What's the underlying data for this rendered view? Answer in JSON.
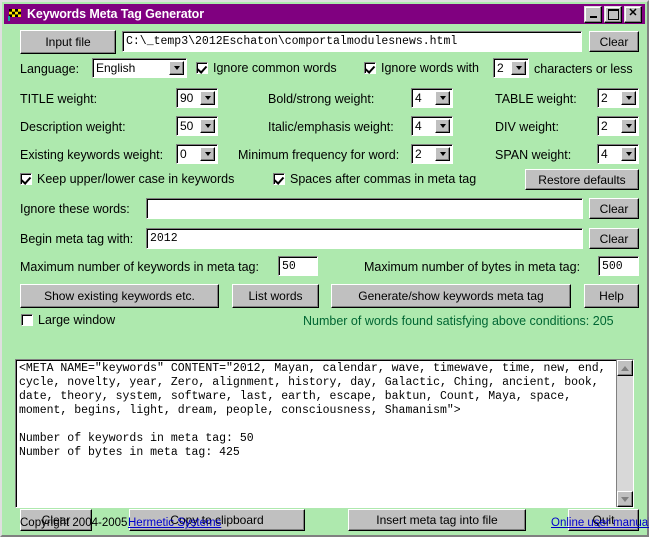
{
  "window": {
    "title": "Keywords Meta Tag Generator",
    "icon": "checkered-flag-icon",
    "minimize_label": "_",
    "maximize_label": "□",
    "close_label": "×",
    "titlebar_color": "#800080",
    "body_color": "#aee9ae"
  },
  "input_file": {
    "button_label": "Input file",
    "path_value": "C:\\_temp3\\2012Eschaton\\comportalmodulesnews.html",
    "clear_label": "Clear"
  },
  "language": {
    "label": "Language:",
    "value": "English"
  },
  "options": {
    "ignore_common_words_label": "Ignore common words",
    "ignore_common_words_checked": true,
    "ignore_short_words_label": "Ignore words with",
    "ignore_short_words_checked": true,
    "ignore_short_words_value": "2",
    "ignore_short_words_suffix": "characters or less",
    "keep_case_label": "Keep upper/lower case in keywords",
    "keep_case_checked": true,
    "spaces_after_commas_label": "Spaces after commas in meta tag",
    "spaces_after_commas_checked": true,
    "large_window_label": "Large window",
    "large_window_checked": false,
    "restore_defaults_label": "Restore defaults"
  },
  "weights": [
    {
      "label": "TITLE weight:",
      "value": "90"
    },
    {
      "label": "Description weight:",
      "value": "50"
    },
    {
      "label": "Existing keywords weight:",
      "value": "0"
    },
    {
      "label": "Bold/strong weight:",
      "value": "4"
    },
    {
      "label": "Italic/emphasis weight:",
      "value": "4"
    },
    {
      "label": "Minimum frequency for word:",
      "value": "2"
    },
    {
      "label": "TABLE weight:",
      "value": "2"
    },
    {
      "label": "DIV weight:",
      "value": "2"
    },
    {
      "label": "SPAN weight:",
      "value": "4"
    }
  ],
  "ignore_words": {
    "label": "Ignore these words:",
    "value": "",
    "clear_label": "Clear"
  },
  "begin_meta": {
    "label": "Begin meta tag with:",
    "value": "2012",
    "clear_label": "Clear"
  },
  "limits": {
    "max_keywords_label": "Maximum number of keywords in meta tag:",
    "max_keywords_value": "50",
    "max_bytes_label": "Maximum number of bytes in meta tag:",
    "max_bytes_value": "500"
  },
  "actions": {
    "show_existing_label": "Show existing  keywords etc.",
    "list_words_label": "List words",
    "generate_label": "Generate/show keywords meta tag",
    "help_label": "Help"
  },
  "status": {
    "text": "Number of words found satisfying above conditions: 205",
    "color": "#006633"
  },
  "output": {
    "text": "<META NAME=\"keywords\" CONTENT=\"2012, Mayan, calendar, wave, timewave, time, new, end,\ncycle, novelty, year, Zero, alignment, history, day, Galactic, Ching, ancient, book,\ndate, theory, system, software, last, earth, escape, baktun, Count, Maya, space,\nmoment, begins, light, dream, people, consciousness, Shamanism\">\n\nNumber of keywords in meta tag: 50\nNumber of bytes in meta tag: 425"
  },
  "bottom_buttons": {
    "clear_label": "Clear",
    "copy_label": "Copy to clipboard",
    "insert_label": "Insert meta tag into file",
    "quit_label": "Quit"
  },
  "footer": {
    "copyright": "Copyright 2004-2005",
    "company_link": "Hermetic Systems",
    "manual_link": "Online user manual",
    "link_color": "#0000cc"
  }
}
